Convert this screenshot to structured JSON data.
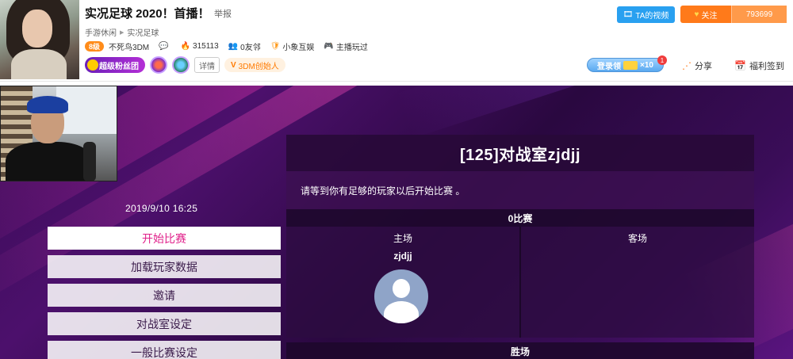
{
  "stream": {
    "title": "实况足球 2020！首播！",
    "report_label": "举报",
    "breadcrumb": [
      "手游休闲",
      "实况足球"
    ],
    "level_badge": "8级",
    "streamer_name": "不死鸟3DM",
    "hot_count": "315113",
    "friends_label": "0友邻",
    "guild_name": "小象互娱",
    "play_label": "主播玩过",
    "fan_badge": "超级粉丝团",
    "detail_label": "详情",
    "founder_badge": "3DM创始人"
  },
  "actions": {
    "video_button": "TA的视频",
    "follow_label": "关注",
    "follow_count": "793699",
    "login_label": "登录领",
    "login_multiplier": "×10",
    "notify_count": "1",
    "share_label": "分享",
    "signin_label": "福利签到"
  },
  "game": {
    "timestamp": "2019/9/10 16:25",
    "menu": [
      {
        "label": "开始比赛",
        "active": true
      },
      {
        "label": "加载玩家数据",
        "active": false
      },
      {
        "label": "邀请",
        "active": false
      },
      {
        "label": "对战室设定",
        "active": false
      },
      {
        "label": "一般比赛设定",
        "active": false
      }
    ],
    "room_title": "[125]对战室zjdjj",
    "room_message": "请等到你有足够的玩家以后开始比赛 。",
    "match_count_label": "0比赛",
    "home_label": "主场",
    "away_label": "客场",
    "home_player": "zjdjj",
    "wins_label": "胜场"
  }
}
